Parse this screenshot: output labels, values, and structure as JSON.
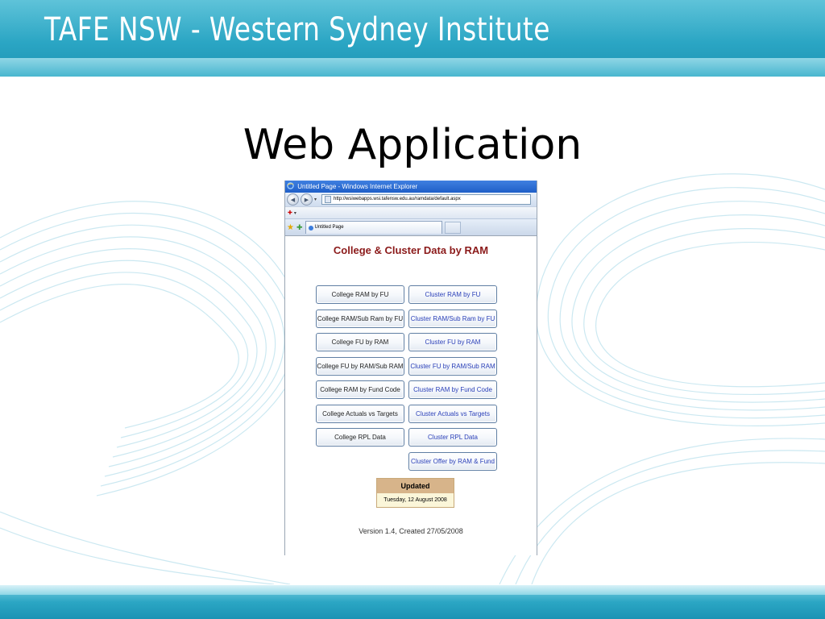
{
  "slide": {
    "header_title": "TAFE NSW - Western Sydney Institute",
    "title": "Web Application"
  },
  "browser": {
    "window_title": "Untitled Page - Windows Internet Explorer",
    "address": "http://wsiwebapps.wsi.tafensw.edu.au/ramdata/default.aspx",
    "tab_label": "Untitled Page"
  },
  "page": {
    "heading": "College & Cluster Data by RAM",
    "rows": [
      {
        "college": "College RAM by FU",
        "cluster": "Cluster RAM by FU"
      },
      {
        "college": "College RAM/Sub Ram by FU",
        "cluster": "Cluster RAM/Sub Ram by FU"
      },
      {
        "college": "College FU by RAM",
        "cluster": "Cluster FU by RAM"
      },
      {
        "college": "College FU by RAM/Sub RAM",
        "cluster": "Cluster FU by RAM/Sub RAM"
      },
      {
        "college": "College RAM by Fund Code",
        "cluster": "Cluster RAM by Fund Code"
      },
      {
        "college": "College Actuals vs Targets",
        "cluster": "Cluster Actuals vs Targets"
      },
      {
        "college": "College RPL Data",
        "cluster": "Cluster RPL Data"
      },
      {
        "college": "",
        "cluster": "Cluster Offer by RAM & Fund"
      }
    ],
    "updated_label": "Updated",
    "updated_date": "Tuesday, 12 August 2008",
    "version": "Version 1.4, Created 27/05/2008"
  },
  "colors": {
    "header_band": "#2ba6c4",
    "heading_text": "#8b1a1a",
    "cluster_text": "#2a3fb8",
    "updated_head": "#d7b48a"
  }
}
